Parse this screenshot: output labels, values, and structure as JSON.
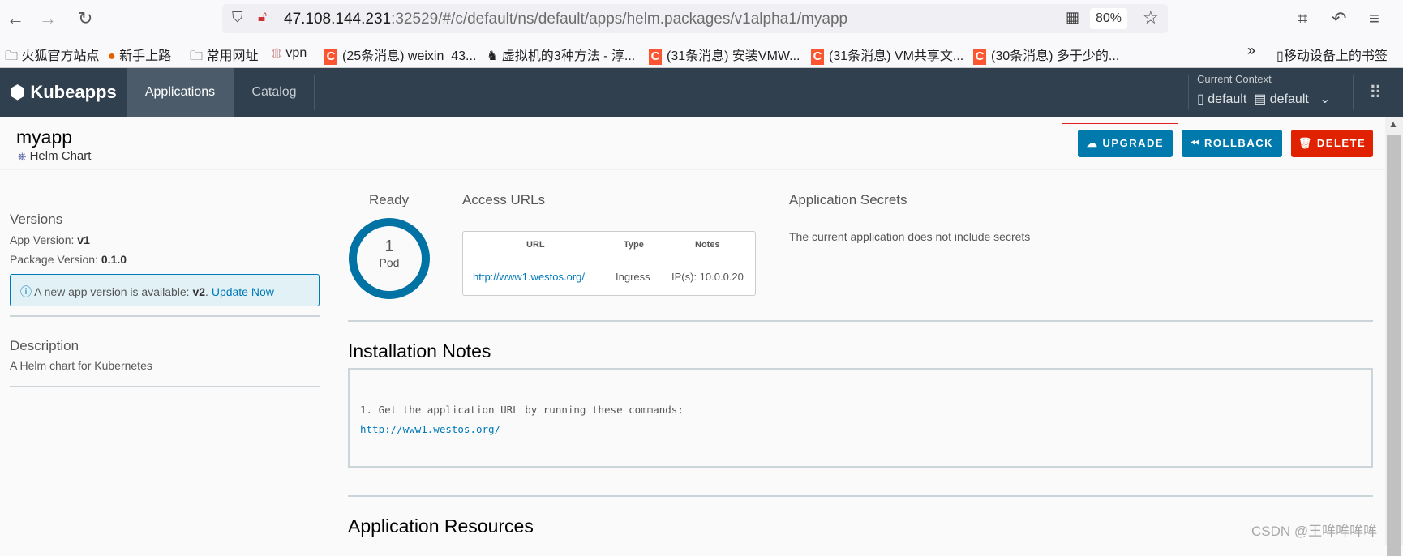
{
  "browser": {
    "url_host": "47.108.144.231",
    "url_rest": ":32529/#/c/default/ns/default/apps/helm.packages/v1alpha1/myapp",
    "zoom": "80%",
    "bookmarks": [
      "火狐官方站点",
      "新手上路",
      "常用网址",
      "vpn",
      "(25条消息) weixin_43...",
      "虚拟机的3种方法 - 淳...",
      "(31条消息) 安装VMW...",
      "(31条消息) VM共享文...",
      "(30条消息) 多于少的..."
    ],
    "mobile_bookmarks": "移动设备上的书签"
  },
  "nav": {
    "logo": "Kubeapps",
    "tabs": [
      "Applications",
      "Catalog"
    ],
    "context_label": "Current Context",
    "cluster": "default",
    "namespace": "default"
  },
  "app": {
    "name": "myapp",
    "type": "Helm Chart"
  },
  "actions": {
    "upgrade": "UPGRADE",
    "rollback": "ROLLBACK",
    "delete": "DELETE"
  },
  "sidebar": {
    "versions_title": "Versions",
    "app_version_label": "App Version:",
    "app_version": "v1",
    "package_version_label": "Package Version:",
    "package_version": "0.1.0",
    "alert_text": "A new app version is available:",
    "alert_version": "v2",
    "alert_link": "Update Now",
    "description_title": "Description",
    "description": "A Helm chart for Kubernetes"
  },
  "status": {
    "title": "Ready",
    "count": "1",
    "unit": "Pod"
  },
  "access_urls": {
    "title": "Access URLs",
    "headers": [
      "URL",
      "Type",
      "Notes"
    ],
    "rows": [
      {
        "url": "http://www1.westos.org/",
        "type": "Ingress",
        "notes": "IP(s): 10.0.0.20"
      }
    ]
  },
  "secrets": {
    "title": "Application Secrets",
    "text": "The current application does not include secrets"
  },
  "notes": {
    "title": "Installation Notes",
    "lines": [
      "1. Get the application URL by running these commands:",
      "http://www1.westos.org/"
    ]
  },
  "resources": {
    "title": "Application Resources"
  },
  "watermark": "CSDN @王哞哞哞哞",
  "colors": {
    "nav": "#30404f",
    "primary": "#0079ad",
    "danger": "#e12200"
  }
}
